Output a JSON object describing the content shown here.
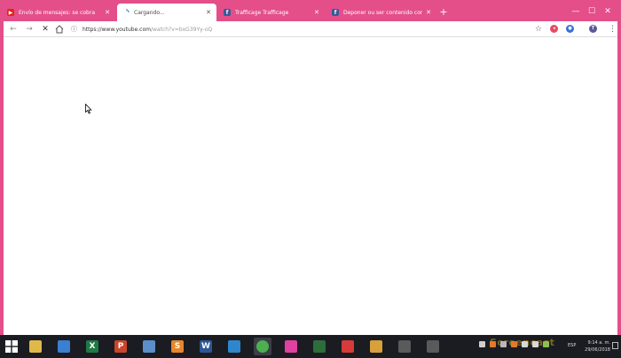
{
  "tabs": [
    {
      "title": "Envío de mensajes: se cobra",
      "favicon": "youtube-icon",
      "active": false
    },
    {
      "title": "Cargando...",
      "favicon": "loading-icon",
      "active": true
    },
    {
      "title": "Trafficage Trafficage",
      "favicon": "facebook-icon",
      "active": false
    },
    {
      "title": "Deponer ou ser contenido comp...",
      "favicon": "facebook-icon",
      "active": false
    }
  ],
  "toolbar": {
    "url_base": "https://www.youtube.com",
    "url_path": "/watch?v=bxG39Yy-oQ"
  },
  "taskbar": {
    "apps": [
      {
        "name": "file-explorer",
        "glyph": "",
        "color": "#e0b84a"
      },
      {
        "name": "network",
        "glyph": "",
        "color": "#3a7fd1"
      },
      {
        "name": "excel",
        "glyph": "X",
        "color": "#1f7a45"
      },
      {
        "name": "powerpoint",
        "glyph": "P",
        "color": "#c9452b"
      },
      {
        "name": "remote-desktop",
        "glyph": "",
        "color": "#5a8fc9"
      },
      {
        "name": "sublime",
        "glyph": "S",
        "color": "#e8862a"
      },
      {
        "name": "word",
        "glyph": "W",
        "color": "#2b5797"
      },
      {
        "name": "app-window",
        "glyph": "",
        "color": "#2e87cc"
      },
      {
        "name": "chrome",
        "glyph": "",
        "color": "#4caf50"
      },
      {
        "name": "pink-app",
        "glyph": "",
        "color": "#e040a0"
      },
      {
        "name": "green-app",
        "glyph": "",
        "color": "#2c6e3a"
      },
      {
        "name": "red-app",
        "glyph": "",
        "color": "#d83a3a"
      },
      {
        "name": "media-player",
        "glyph": "",
        "color": "#d8a03a"
      },
      {
        "name": "dark-app",
        "glyph": "",
        "color": "#5a5a5a"
      },
      {
        "name": "dark-app-2",
        "glyph": "",
        "color": "#5a5a5a"
      }
    ],
    "lang": "ESP",
    "time": "9:14 a. m.",
    "date": "29/06/2018",
    "watermark": "Screencast"
  },
  "colors": {
    "chrome_frame": "#e44f8a",
    "page_bg": "#ffffff",
    "taskbar_bg": "#1b1c22"
  }
}
